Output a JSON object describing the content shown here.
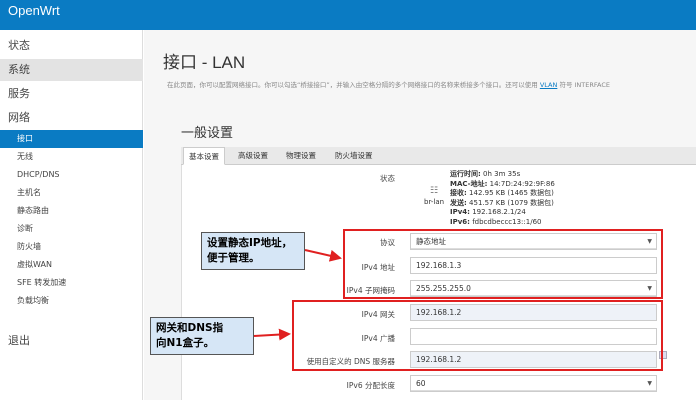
{
  "brand": "OpenWrt",
  "nav": {
    "status": "状态",
    "system": "系统",
    "services": "服务",
    "network": "网络",
    "network_items": [
      "接口",
      "无线",
      "DHCP/DNS",
      "主机名",
      "静态路由",
      "诊断",
      "防火墙",
      "虚拟WAN",
      "SFE 转发加速",
      "负载均衡"
    ],
    "logout": "退出"
  },
  "page": {
    "title": "接口 - LAN",
    "desc_prefix": "在此页面，你可以配置网络接口。你可以勾选“桥接接口”，并输入由空格分隔的多个网络接口的名称来桥接多个接口。还可以使用",
    "desc_link": "VLAN",
    "desc_suffix": "符号 INTERFACE",
    "section_title": "一般设置"
  },
  "tabs": [
    "基本设置",
    "高级设置",
    "物理设置",
    "防火墙设置"
  ],
  "status": {
    "label": "状态",
    "iface": "br-lan",
    "uptime_k": "运行时间:",
    "uptime_v": "0h 3m 35s",
    "mac_k": "MAC-地址:",
    "mac_v": "14:7D:24:92:9F:86",
    "rx_k": "接收:",
    "rx_v": "142.95 KB (1465 数据包)",
    "tx_k": "发送:",
    "tx_v": "451.57 KB (1079 数据包)",
    "ipv4_k": "IPv4:",
    "ipv4_v": "192.168.2.1/24",
    "ipv6_k": "IPv6:",
    "ipv6_v": "fdbcdbeccc13::1/60"
  },
  "form": {
    "protocol_label": "协议",
    "protocol_value": "静态地址",
    "ipv4_addr_label": "IPv4 地址",
    "ipv4_addr_value": "192.168.1.3",
    "netmask_label": "IPv4 子网掩码",
    "netmask_value": "255.255.255.0",
    "gateway_label": "IPv4 网关",
    "gateway_value": "192.168.1.2",
    "broadcast_label": "IPv4 广播",
    "broadcast_value": "",
    "dns_label": "使用自定义的 DNS 服务器",
    "dns_value": "192.168.1.2",
    "ipv6_assign_label": "IPv6 分配长度",
    "ipv6_assign_value": "60"
  },
  "annotations": {
    "callout1_line1": "设置静态IP地址，",
    "callout1_line2": "便于管理。",
    "callout2_line1": "网关和DNS指",
    "callout2_line2": "向N1盒子。",
    "color_red": "#e02020"
  }
}
